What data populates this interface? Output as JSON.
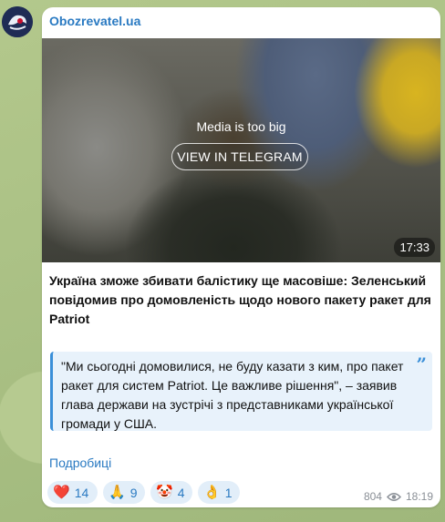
{
  "channel": {
    "name": "Obozrevatel.ua"
  },
  "media": {
    "too_big_text": "Media is too big",
    "view_button": "VIEW IN TELEGRAM",
    "duration": "17:33"
  },
  "post": {
    "title": "Україна зможе збивати балістику ще масовіше: Зеленський повідомив про домовленість щодо нового пакету ракет для Patriot",
    "quote": "\"Ми сьогодні домовилися, не буду казати з ким, про пакет ракет для систем Patriot. Це важливе рішення\", – заявив глава держави на зустрічі з представниками української громади у США.",
    "more_link": "Подробиці"
  },
  "reactions": [
    {
      "icon": "heart-icon",
      "emoji": "❤️",
      "count": "14"
    },
    {
      "icon": "pray-icon",
      "emoji": "🙏",
      "count": "9"
    },
    {
      "icon": "clown-icon",
      "emoji": "🤡",
      "count": "4"
    },
    {
      "icon": "ok-hand-icon",
      "emoji": "👌",
      "count": "1"
    }
  ],
  "meta": {
    "views": "804",
    "time": "18:19"
  }
}
